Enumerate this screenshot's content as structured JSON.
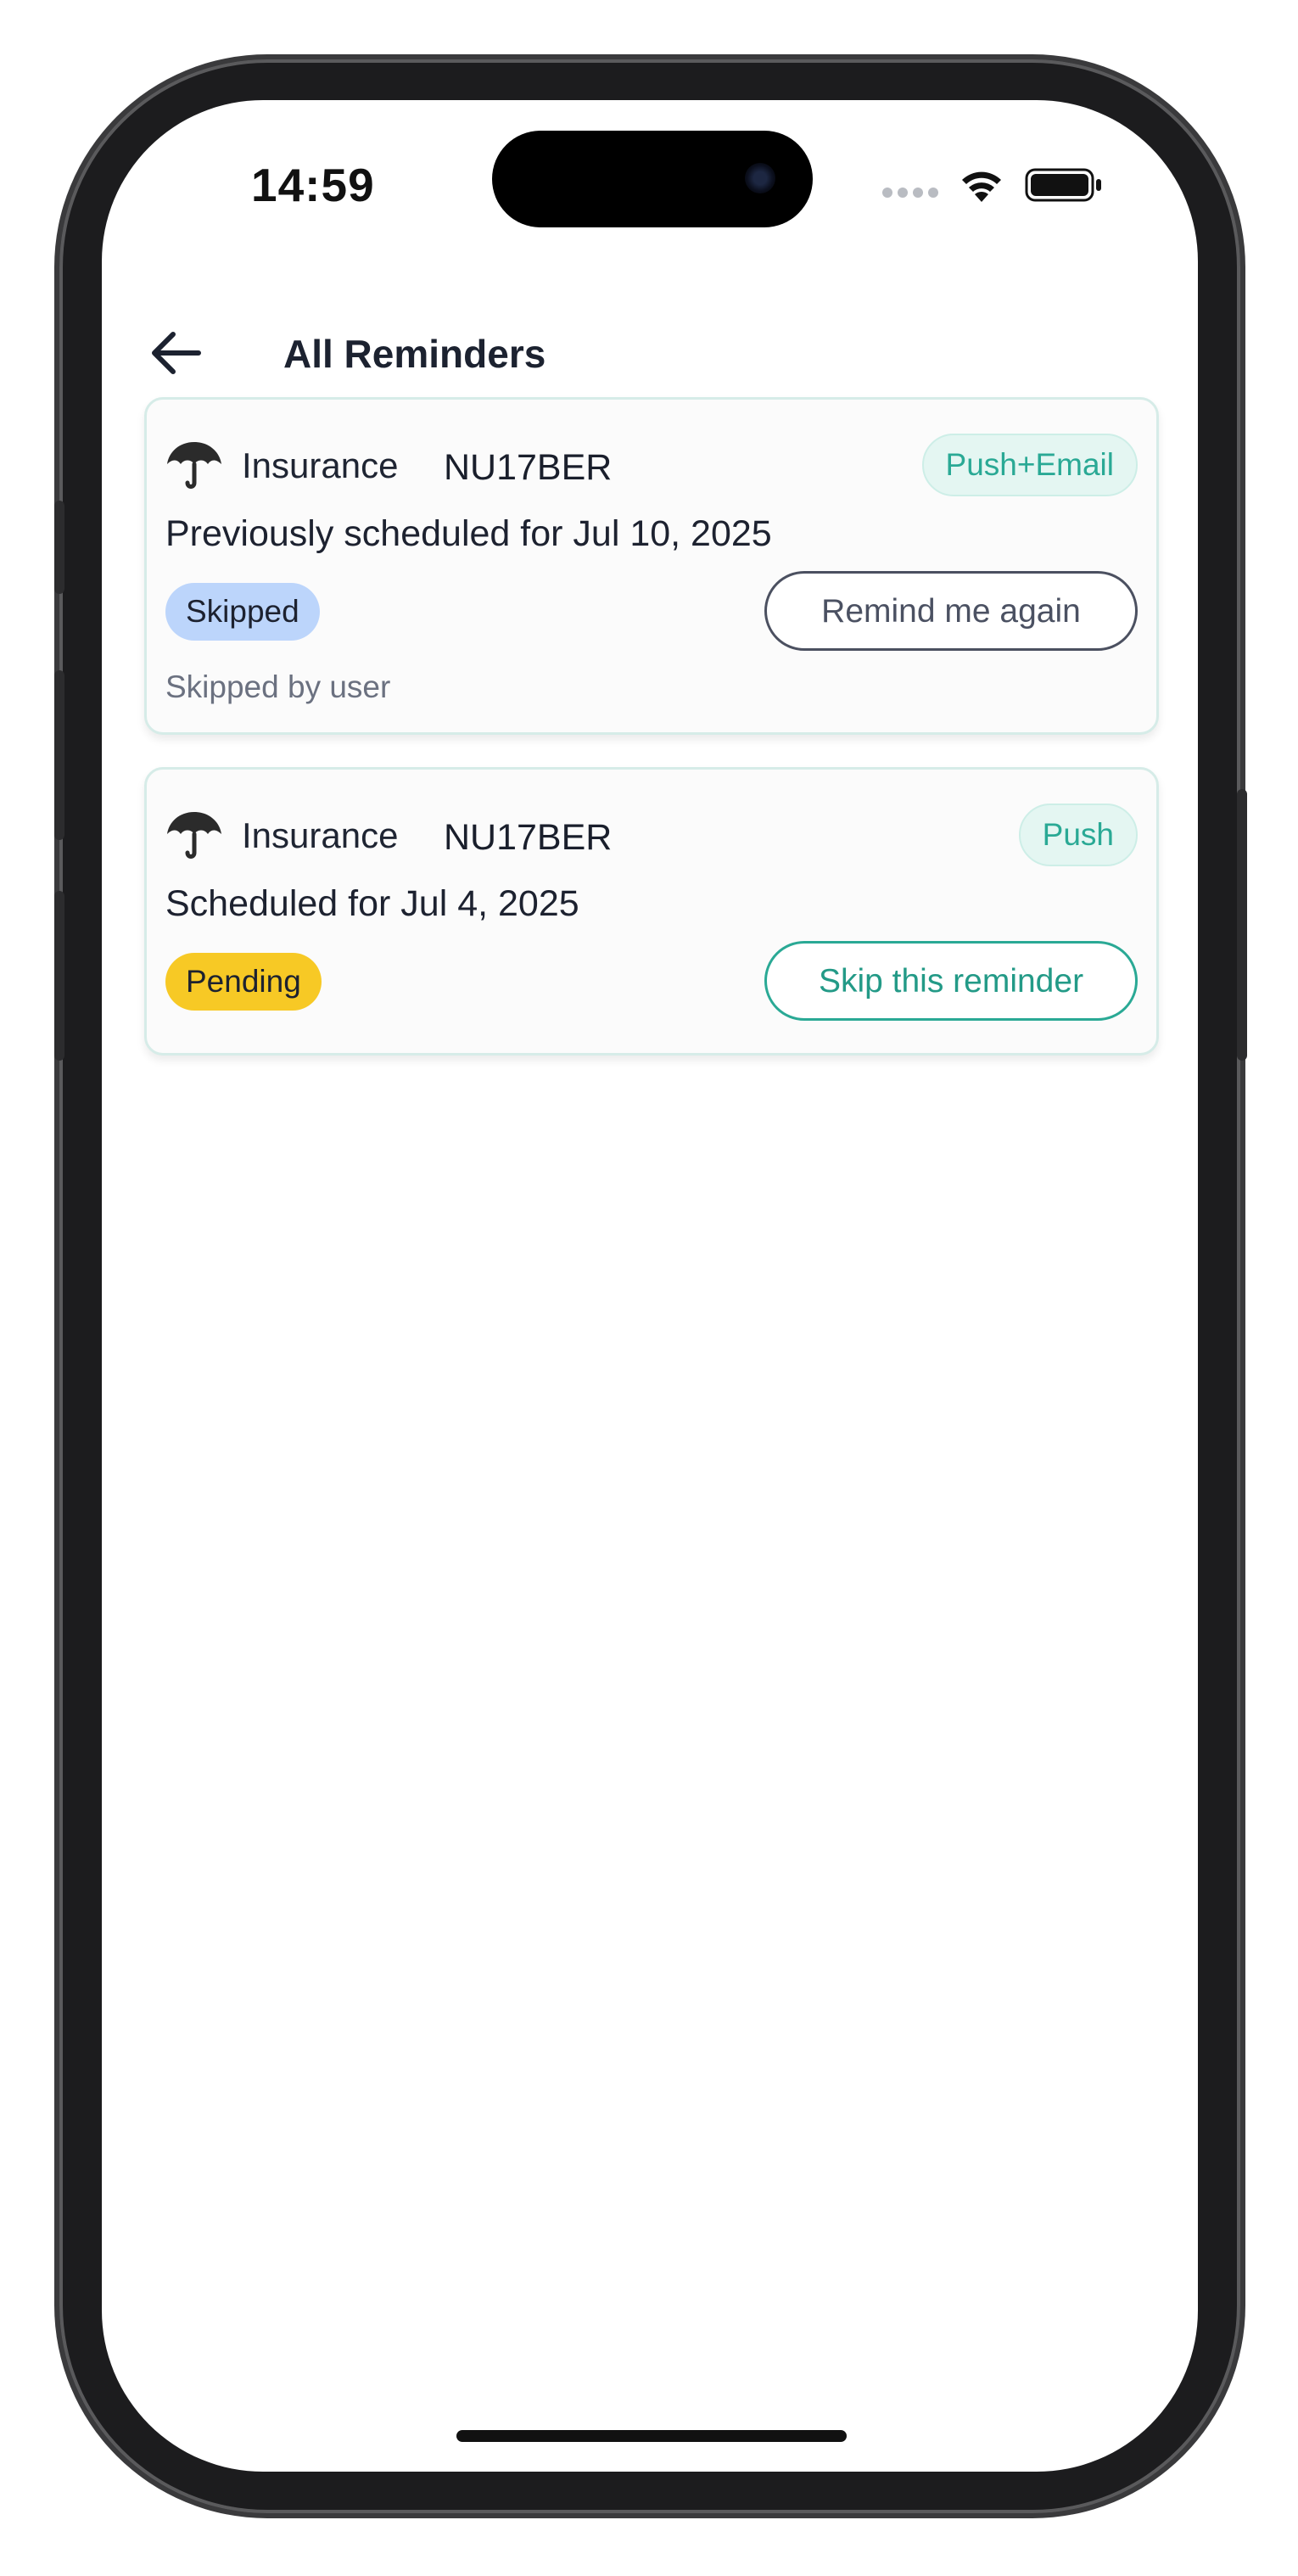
{
  "status_bar": {
    "time": "14:59"
  },
  "header": {
    "title": "All Reminders",
    "back_icon": "arrow-left-icon"
  },
  "reminders": [
    {
      "category": "Insurance",
      "category_icon": "umbrella-icon",
      "plate": "NU17BER",
      "channel": "Push+Email",
      "schedule_text": "Previously scheduled for Jul 10, 2025",
      "status": "Skipped",
      "status_color": "#bcd5fb",
      "action_label": "Remind me again",
      "note": "Skipped by user"
    },
    {
      "category": "Insurance",
      "category_icon": "umbrella-icon",
      "plate": "NU17BER",
      "channel": "Push",
      "schedule_text": "Scheduled for Jul 4, 2025",
      "status": "Pending",
      "status_color": "#f7c925",
      "action_label": "Skip this reminder"
    }
  ],
  "colors": {
    "accent": "#2aa995",
    "card_border": "#d6ece8",
    "title_text": "#1c2230"
  }
}
